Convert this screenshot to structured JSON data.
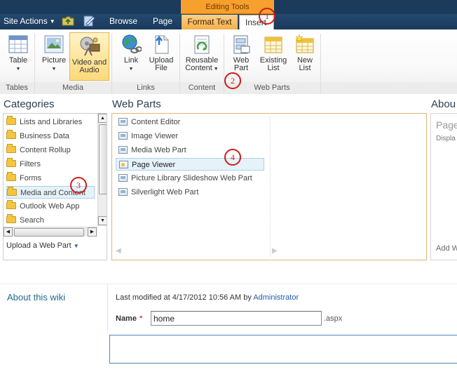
{
  "topbar": {
    "site_actions": "Site Actions",
    "tabs": {
      "browse": "Browse",
      "page": "Page"
    },
    "contextual_group": "Editing Tools",
    "contextual_tabs": {
      "format_text": "Format Text",
      "insert": "Insert"
    }
  },
  "ribbon": {
    "buttons": {
      "table": "Table",
      "picture": "Picture",
      "video_line1": "Video and",
      "video_line2": "Audio",
      "link": "Link",
      "upload_line1": "Upload",
      "upload_line2": "File",
      "reusable_line1": "Reusable",
      "reusable_line2": "Content",
      "webpart_line1": "Web",
      "webpart_line2": "Part",
      "existing_line1": "Existing",
      "existing_line2": "List",
      "newlist_line1": "New",
      "newlist_line2": "List"
    },
    "groups": {
      "tables": "Tables",
      "media": "Media",
      "links": "Links",
      "content": "Content",
      "web_parts": "Web Parts"
    }
  },
  "categories": {
    "title": "Categories",
    "items": [
      "Lists and Libraries",
      "Business Data",
      "Content Rollup",
      "Filters",
      "Forms",
      "Media and Content",
      "Outlook Web App",
      "Search"
    ],
    "selected_index": 5,
    "upload_link": "Upload a Web Part"
  },
  "web_parts": {
    "title": "Web Parts",
    "items": [
      "Content Editor",
      "Image Viewer",
      "Media Web Part",
      "Page Viewer",
      "Picture Library Slideshow Web Part",
      "Silverlight Web Part"
    ],
    "selected_index": 3
  },
  "about": {
    "title": "Abou",
    "part_name": "Page",
    "description": "Displa",
    "add_link": "Add W"
  },
  "wiki": {
    "about_heading": "About this wiki",
    "last_modified_prefix": "Last modified at 4/17/2012 10:56 AM by",
    "modified_by": "Administrator",
    "name_label": "Name",
    "required_mark": "*",
    "name_value": "home",
    "extension": ".aspx"
  },
  "markers": [
    "1",
    "2",
    "3",
    "4"
  ],
  "colors": {
    "topbar": "#1b3a5c",
    "contextual_tab": "#f7a02e",
    "selection": "#e6f2fa",
    "marker": "#d11a1a",
    "link": "#1f5fa8"
  }
}
